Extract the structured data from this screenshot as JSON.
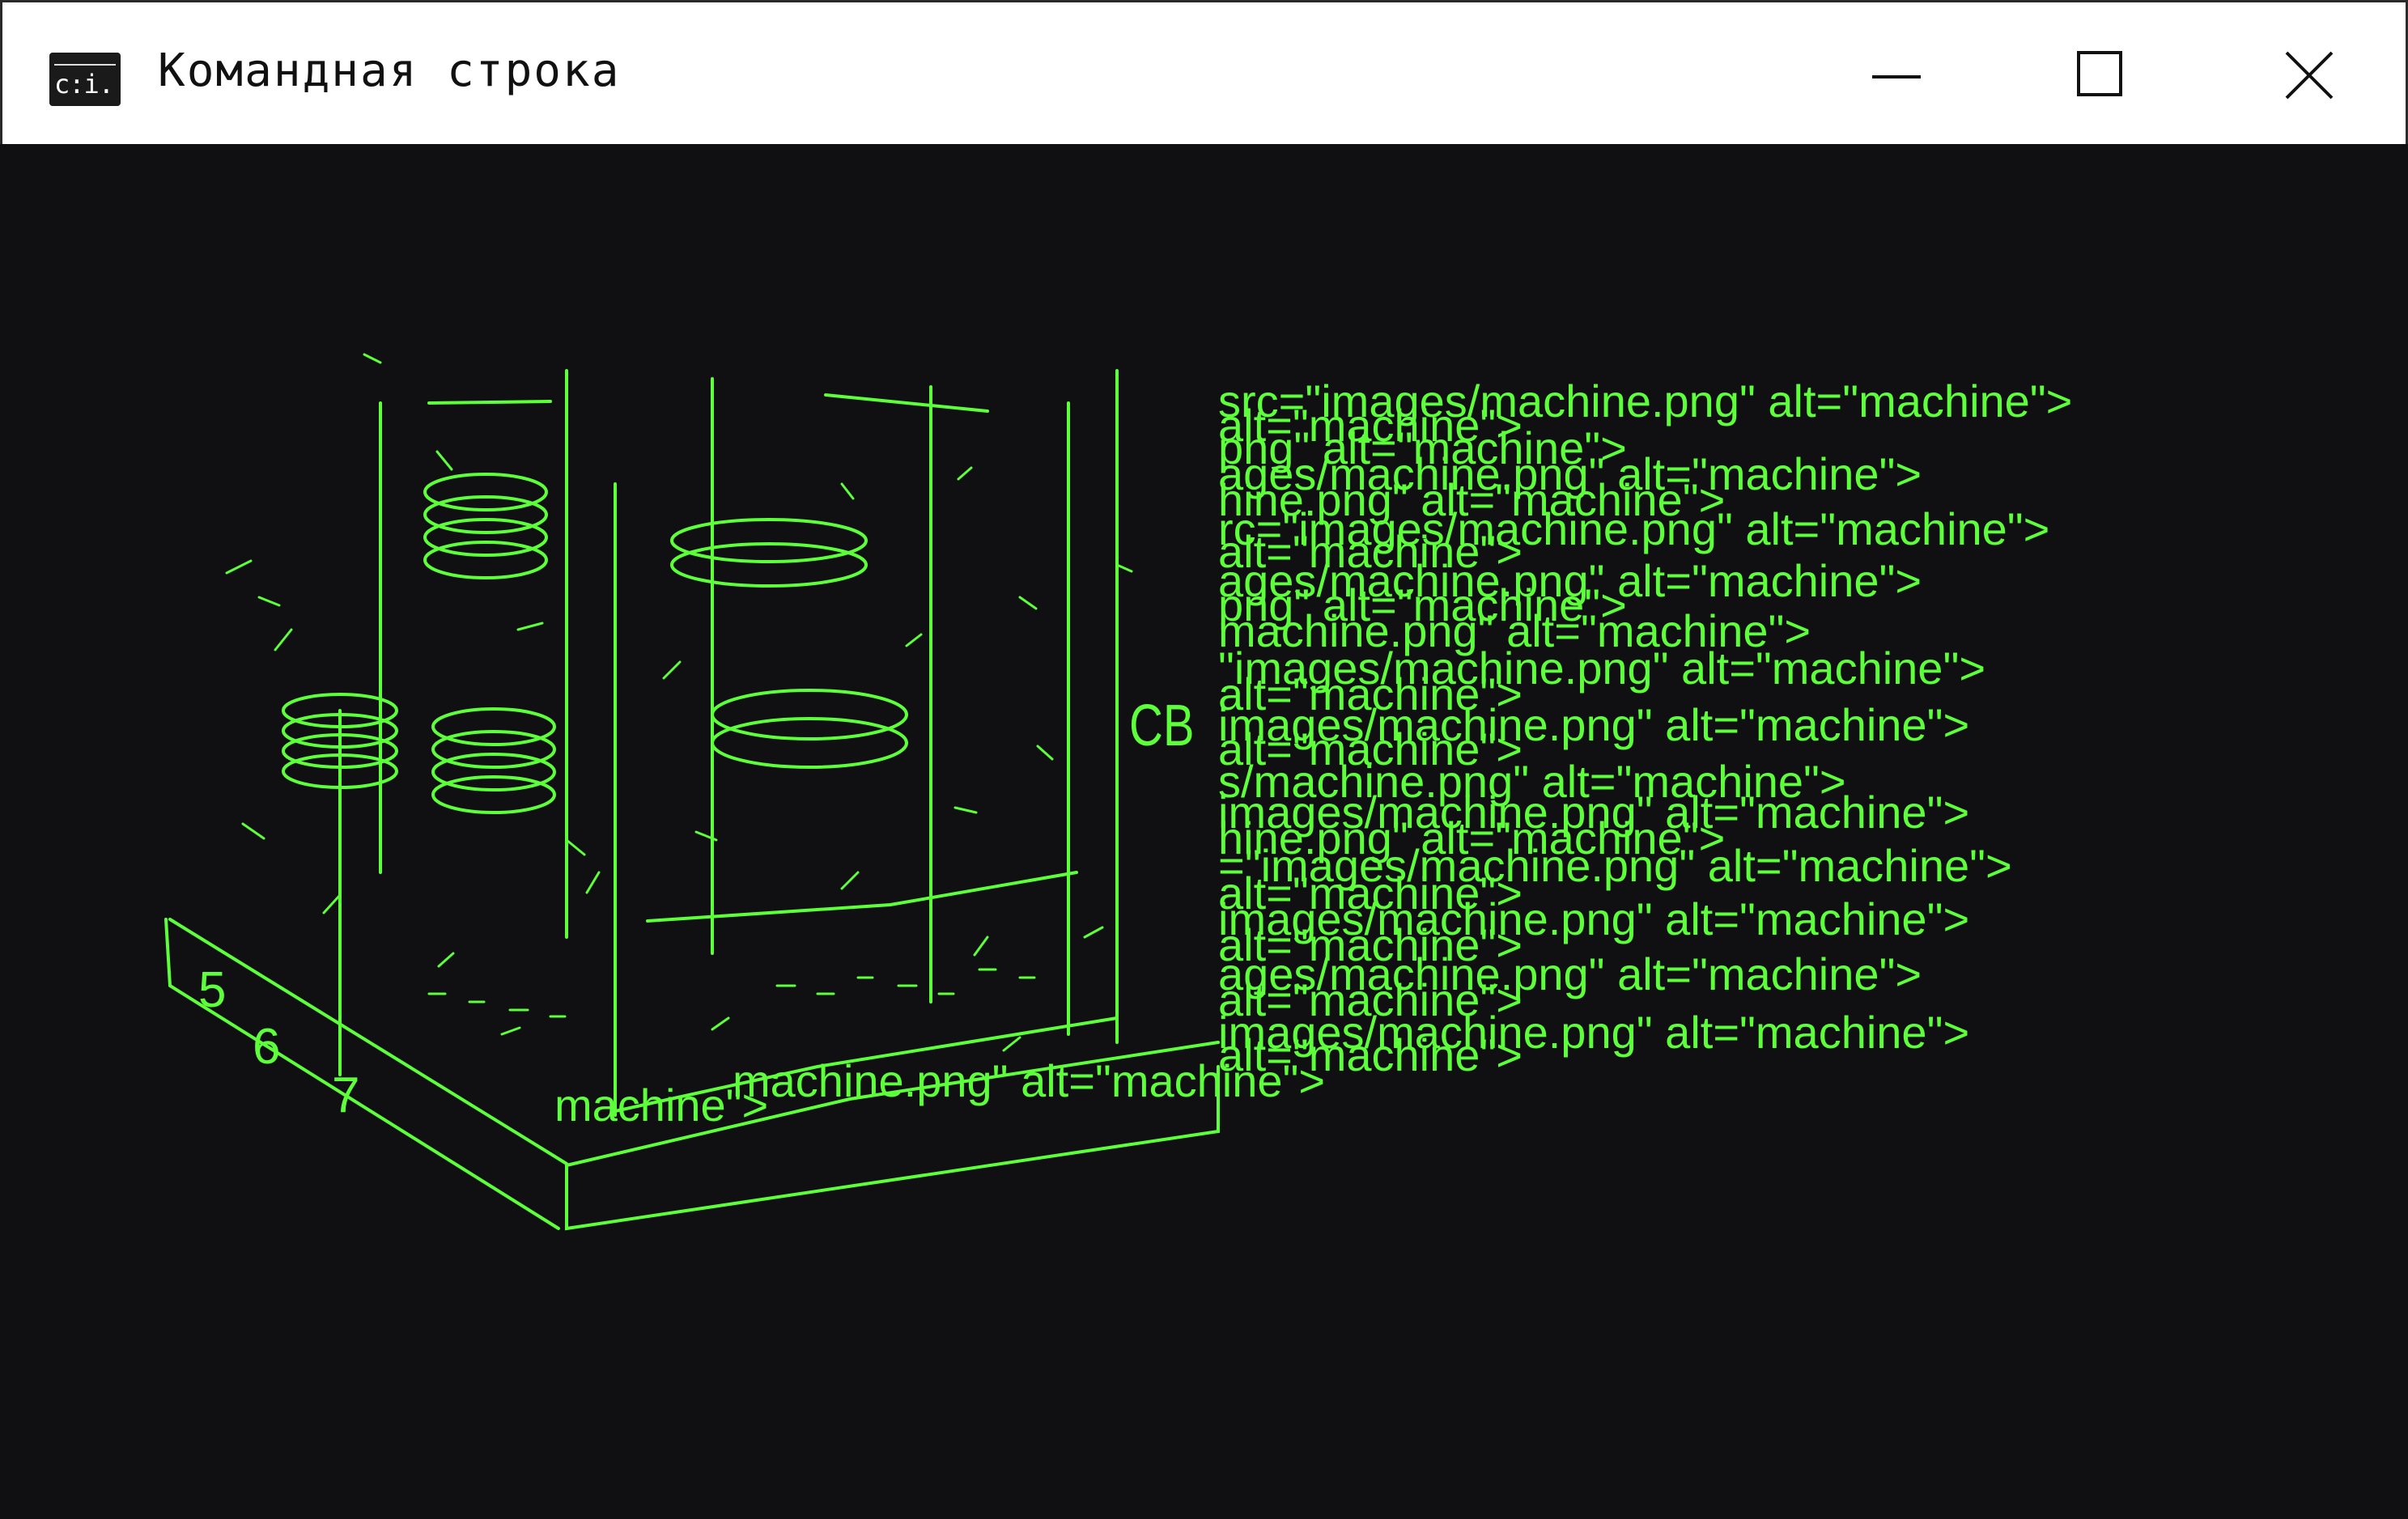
{
  "window": {
    "title": "Командная строка",
    "app_icon_label": "c:i.",
    "icons": {
      "app": "command-prompt-icon",
      "minimize": "minimize-icon",
      "maximize": "maximize-icon",
      "close": "close-icon"
    }
  },
  "console": {
    "background": "#101012",
    "text_color": "#5dff3a",
    "drawing_label": "CB",
    "drawing_digits": [
      "5",
      "6",
      "7"
    ],
    "code_lines": [
      "src=\"images/machine.png\" alt=\"machine\">",
      "alt=\"machine\">",
      "png\" alt=\"machine\">",
      "ages/machine.png\" alt=\"machine\">",
      "hine.png\" alt=\"machine\">",
      "rc=\"images/machine.png\" alt=\"machine\">",
      "alt=\"machine\">",
      "ages/machine.png\" alt=\"machine\">",
      "png\" alt=\"machine\">",
      "machine.png\" alt=\"machine\">",
      "\"images/machine.png\" alt=\"machine\">",
      "alt=\"machine\">",
      "images/machine.png\" alt=\"machine\">",
      "alt=\"machine\">",
      "s/machine.png\" alt=\"machine\">",
      "images/machine.png\" alt=\"machine\">",
      "hine.png\" alt=\"machine\">",
      "=\"images/machine.png\" alt=\"machine\">",
      "alt=\"machine\">",
      "images/machine.png\" alt=\"machine\">",
      "alt=\"machine\">",
      "ages/machine.png\" alt=\"machine\">",
      "alt=\"machine\">",
      "images/machine.png\" alt=\"machine\">",
      "alt=\"machine\">",
      "machine.png\" alt=\"machine\">",
      "machine\">"
    ]
  }
}
